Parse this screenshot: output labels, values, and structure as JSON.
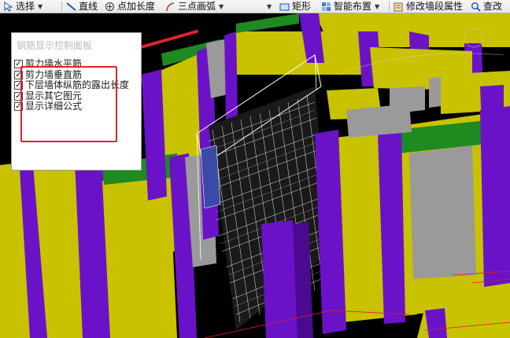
{
  "toolbar": {
    "items": [
      {
        "label": "选择",
        "icon": "pointer-icon",
        "dropdown": true
      },
      {
        "label": "直线",
        "icon": "line-icon",
        "dropdown": false
      },
      {
        "label": "点加长度",
        "icon": "point-length-icon",
        "dropdown": false
      },
      {
        "label": "三点画弧",
        "icon": "arc-icon",
        "dropdown": true
      },
      {
        "label": "矩形",
        "icon": "rectangle-icon",
        "dropdown": false
      },
      {
        "label": "智能布置",
        "icon": "smart-layout-icon",
        "dropdown": true
      },
      {
        "label": "修改墙段属性",
        "icon": "wall-properties-icon",
        "dropdown": false
      },
      {
        "label": "查改",
        "icon": "search-icon",
        "dropdown": false
      }
    ]
  },
  "panel": {
    "title": "钢筋显示控制面板",
    "options": [
      {
        "label": "剪力墙水平筋",
        "checked": true
      },
      {
        "label": "剪力墙垂直筋",
        "checked": true
      },
      {
        "label": "下层墙体纵筋的露出长度",
        "checked": true
      },
      {
        "label": "显示其它图元",
        "checked": true
      },
      {
        "label": "显示详细公式",
        "checked": true
      }
    ]
  },
  "colors": {
    "annotation_red": "#e0242a",
    "wall_yellow": "#c8c200",
    "column_purple": "#6a12c8",
    "slab_green": "#1f8a1f",
    "wall_gray": "#9a9a9a"
  }
}
